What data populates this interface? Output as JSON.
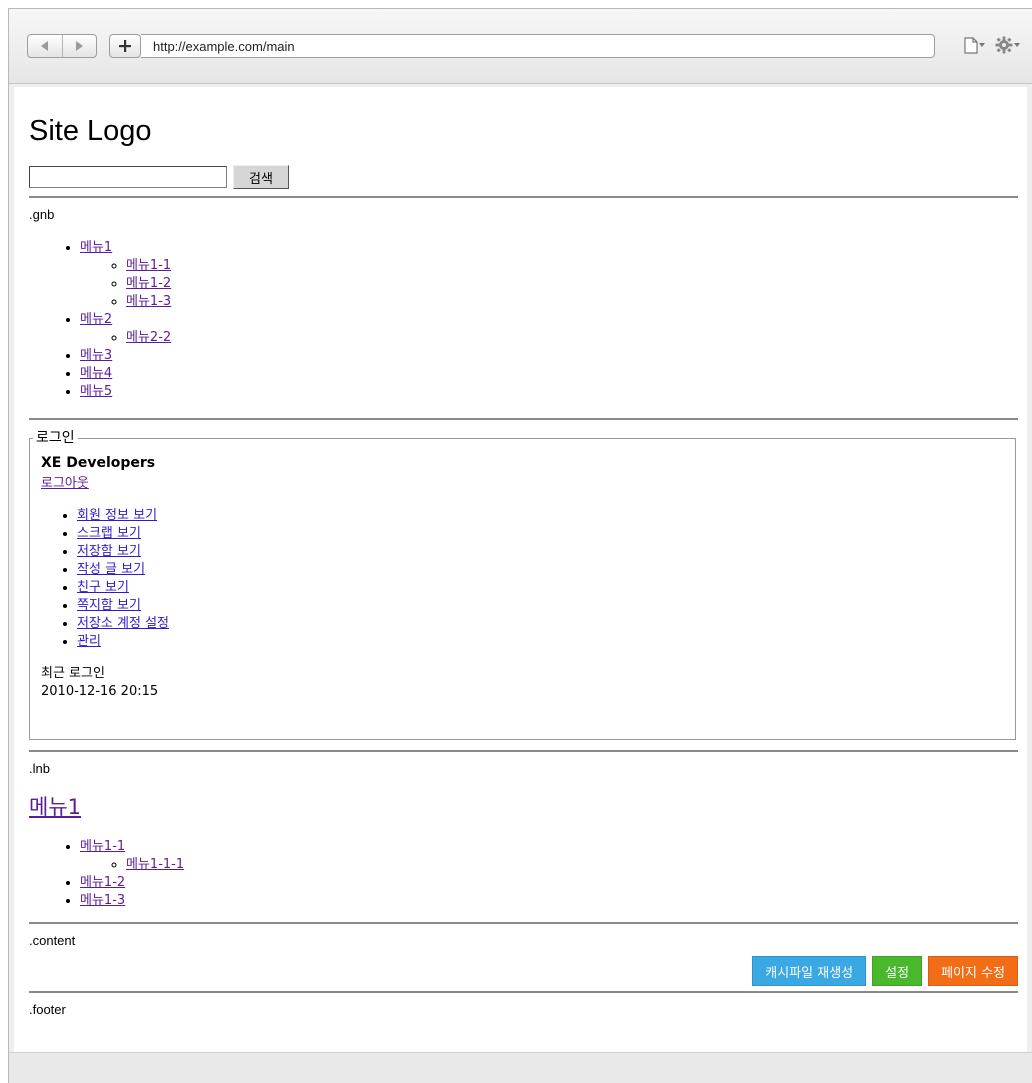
{
  "browser": {
    "url": "http://example.com/main",
    "icons": [
      "back-arrow-icon",
      "forward-arrow-icon",
      "plus-icon",
      "page-icon",
      "gear-icon"
    ]
  },
  "site": {
    "logo": "Site Logo"
  },
  "search": {
    "value": "",
    "button_label": "검색"
  },
  "gnb": {
    "label": ".gnb",
    "menus": [
      {
        "label": "메뉴1",
        "children": [
          "메뉴1-1",
          "메뉴1-2",
          "메뉴1-3"
        ]
      },
      {
        "label": "메뉴2",
        "children": [
          "메뉴2-2"
        ]
      },
      {
        "label": "메뉴3",
        "children": []
      },
      {
        "label": "메뉴4",
        "children": []
      },
      {
        "label": "메뉴5",
        "children": []
      }
    ]
  },
  "login": {
    "legend": "로그인",
    "nick": "XE Developers",
    "logout": "로그아웃",
    "links": [
      "회원 정보 보기",
      "스크랩 보기",
      "저장함 보기",
      "작성 글 보기",
      "친구 보기",
      "쪽지함 보기",
      "저장소 계정 설정",
      "관리"
    ],
    "last_login_label": "최근 로그인",
    "last_login_time": "2010-12-16 20:15"
  },
  "lnb": {
    "label": ".lnb",
    "title": "메뉴1",
    "menus": [
      {
        "label": "메뉴1-1",
        "children": [
          "메뉴1-1-1"
        ]
      },
      {
        "label": "메뉴1-2",
        "children": []
      },
      {
        "label": "메뉴1-3",
        "children": []
      }
    ]
  },
  "content": {
    "label": ".content",
    "buttons": [
      {
        "label": "캐시파일 재생성",
        "color": "#3aa8e3"
      },
      {
        "label": "설정",
        "color": "#49b82c"
      },
      {
        "label": "페이지 수정",
        "color": "#f36d17"
      }
    ]
  },
  "footer": {
    "label": ".footer"
  }
}
